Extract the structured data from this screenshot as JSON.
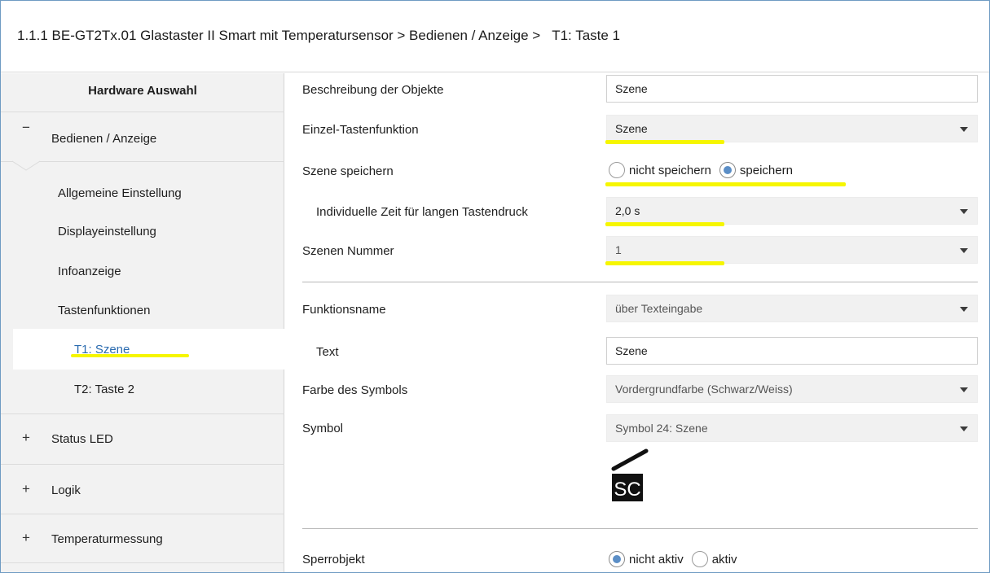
{
  "title": {
    "breadcrumb": "1.1.1 BE-GT2Tx.01 Glastaster II Smart mit Temperatursensor > Bedienen / Anzeige >",
    "current": "T1: Taste 1"
  },
  "sidebar": {
    "header": "Hardware Auswahl",
    "sections": [
      {
        "sign": "−",
        "label": "Bedienen / Anzeige"
      },
      {
        "sign": "+",
        "label": "Status LED"
      },
      {
        "sign": "+",
        "label": "Logik"
      },
      {
        "sign": "+",
        "label": "Temperaturmessung"
      }
    ],
    "subitems": [
      "Allgemeine Einstellung",
      "Displayeinstellung",
      "Infoanzeige",
      "Tastenfunktionen"
    ],
    "active_item": "T1: Szene",
    "next_item": "T2: Taste 2"
  },
  "form": {
    "beschreibung": {
      "label": "Beschreibung der Objekte",
      "value": "Szene"
    },
    "einzel": {
      "label": "Einzel-Tastenfunktion",
      "value": "Szene"
    },
    "szene_speichern": {
      "label": "Szene speichern",
      "option1": "nicht speichern",
      "option2": "speichern",
      "selected": "speichern"
    },
    "zeit": {
      "label": "Individuelle Zeit für langen Tastendruck",
      "value": "2,0 s"
    },
    "nummer": {
      "label": "Szenen Nummer",
      "value": "1"
    },
    "funktionsname": {
      "label": "Funktionsname",
      "value": "über Texteingabe"
    },
    "text": {
      "label": "Text",
      "value": "Szene"
    },
    "farbe": {
      "label": "Farbe des Symbols",
      "value": "Vordergrundfarbe (Schwarz/Weiss)"
    },
    "symbol": {
      "label": "Symbol",
      "value": "Symbol 24: Szene",
      "glyph": "SC"
    },
    "sperrobjekt": {
      "label": "Sperrobjekt",
      "option1": "nicht aktiv",
      "option2": "aktiv",
      "selected": "nicht aktiv"
    }
  },
  "colors": {
    "highlight": "#f6f600",
    "active_link": "#2c6cb0",
    "radio_fill": "#5b8ec6"
  }
}
